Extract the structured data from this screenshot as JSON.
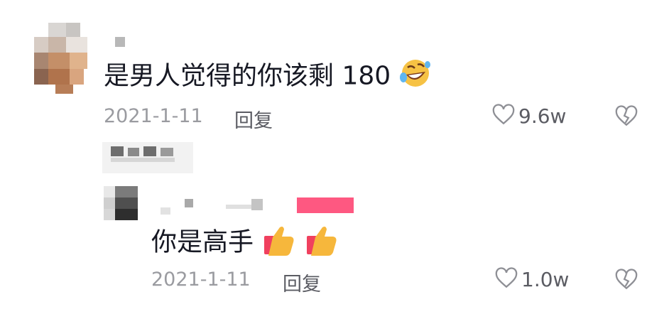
{
  "comments": [
    {
      "text": "是男人觉得的你该剩 180",
      "emoji": "rolling-on-floor-laughing",
      "date": "2021-1-11",
      "reply_label": "回复",
      "likes": "9.6w"
    }
  ],
  "reply": {
    "text": "你是高手",
    "emoji": "thumbs-up x2",
    "date": "2021-1-11",
    "reply_label": "回复",
    "likes": "1.0w"
  },
  "colors": {
    "text": "#161823",
    "meta": "#9a9ba0",
    "badge_pink": "#fe2c55"
  }
}
